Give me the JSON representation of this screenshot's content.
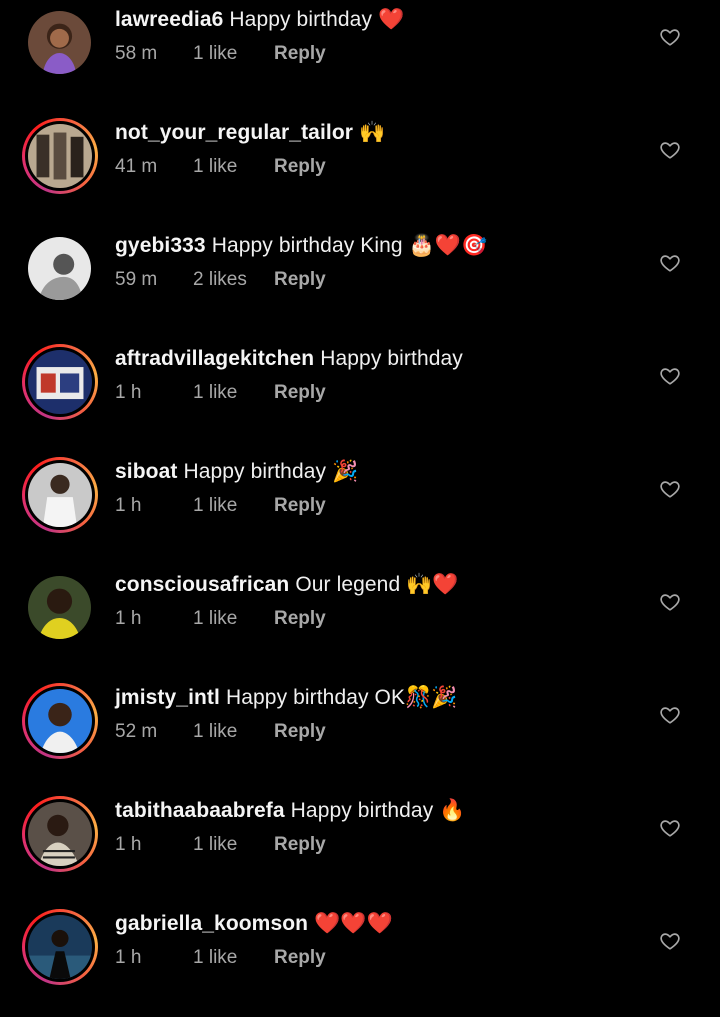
{
  "comments": [
    {
      "username": "lawreedia6",
      "text": "Happy birthday ❤️",
      "time": "58 m",
      "likes": "1 like",
      "reply": "Reply",
      "ring": false,
      "avatar": "woman-smiling-avatar"
    },
    {
      "username": "not_your_regular_tailor",
      "text": "🙌",
      "time": "41 m",
      "likes": "1 like",
      "reply": "Reply",
      "ring": true,
      "avatar": "tailor-mannequins-avatar"
    },
    {
      "username": "gyebi333",
      "text": "Happy birthday King 🎂❤️🎯",
      "time": "59 m",
      "likes": "2 likes",
      "reply": "Reply",
      "ring": false,
      "avatar": "bw-portrait-avatar"
    },
    {
      "username": "aftradvillagekitchen",
      "text": "Happy birthday",
      "time": "1 h",
      "likes": "1 like",
      "reply": "Reply",
      "ring": true,
      "avatar": "kitchen-product-avatar"
    },
    {
      "username": "siboat",
      "text": "Happy birthday 🎉",
      "time": "1 h",
      "likes": "1 like",
      "reply": "Reply",
      "ring": true,
      "avatar": "man-white-suit-avatar"
    },
    {
      "username": "consciousafrican",
      "text": "Our legend 🙌❤️",
      "time": "1 h",
      "likes": "1 like",
      "reply": "Reply",
      "ring": false,
      "avatar": "man-yellow-shirt-avatar"
    },
    {
      "username": "jmisty_intl",
      "text": "Happy birthday OK🎊🎉",
      "time": "52 m",
      "likes": "1 like",
      "reply": "Reply",
      "ring": true,
      "avatar": "man-blue-background-avatar"
    },
    {
      "username": "tabithaabaabrefa",
      "text": "Happy birthday 🔥",
      "time": "1 h",
      "likes": "1 like",
      "reply": "Reply",
      "ring": true,
      "avatar": "woman-striped-avatar"
    },
    {
      "username": "gabriella_koomson",
      "text": "❤️❤️❤️",
      "time": "1 h",
      "likes": "1 like",
      "reply": "Reply",
      "ring": true,
      "avatar": "woman-beach-avatar"
    }
  ],
  "colors": {
    "background": "#000000",
    "meta": "#a8a8a8",
    "text": "#f5f5f5"
  }
}
